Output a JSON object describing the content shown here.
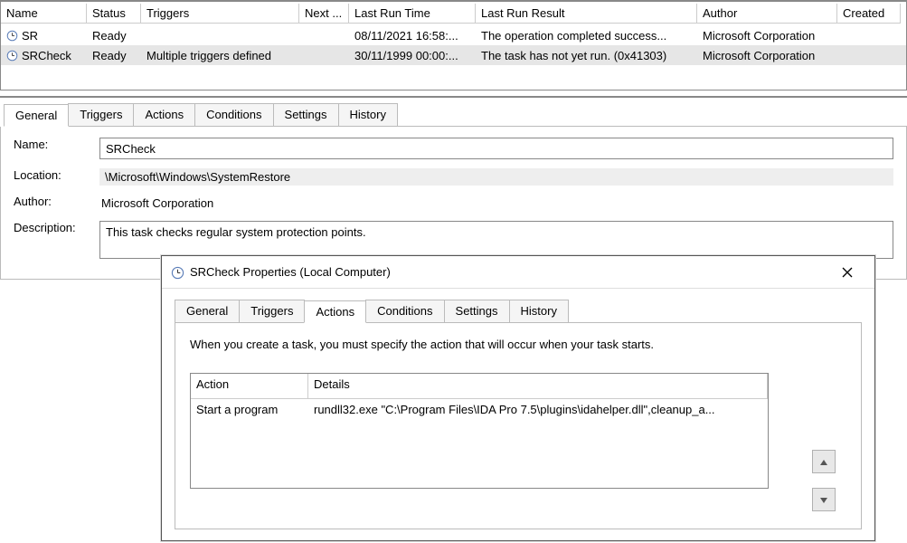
{
  "task_list": {
    "columns": [
      "Name",
      "Status",
      "Triggers",
      "Next ...",
      "Last Run Time",
      "Last Run Result",
      "Author",
      "Created"
    ],
    "rows": [
      {
        "name": "SR",
        "status": "Ready",
        "triggers": "",
        "next": "",
        "last_run_time": "08/11/2021 16:58:...",
        "last_run_result": "The operation completed success...",
        "author": "Microsoft Corporation",
        "created": ""
      },
      {
        "name": "SRCheck",
        "status": "Ready",
        "triggers": "Multiple triggers defined",
        "next": "",
        "last_run_time": "30/11/1999 00:00:...",
        "last_run_result": "The task has not yet run. (0x41303)",
        "author": "Microsoft Corporation",
        "created": ""
      }
    ]
  },
  "outer_tabs": [
    "General",
    "Triggers",
    "Actions",
    "Conditions",
    "Settings",
    "History"
  ],
  "general": {
    "labels": {
      "name": "Name:",
      "location": "Location:",
      "author": "Author:",
      "description": "Description:"
    },
    "name": "SRCheck",
    "location": "\\Microsoft\\Windows\\SystemRestore",
    "author": "Microsoft Corporation",
    "description": "This task checks regular system protection points."
  },
  "dialog": {
    "title": "SRCheck Properties (Local Computer)",
    "tabs": [
      "General",
      "Triggers",
      "Actions",
      "Conditions",
      "Settings",
      "History"
    ],
    "help_text": "When you create a task, you must specify the action that will occur when your task starts.",
    "action_columns": [
      "Action",
      "Details"
    ],
    "action_rows": [
      {
        "action": "Start a program",
        "details": "rundll32.exe \"C:\\Program Files\\IDA Pro 7.5\\plugins\\idahelper.dll\",cleanup_a..."
      }
    ]
  }
}
